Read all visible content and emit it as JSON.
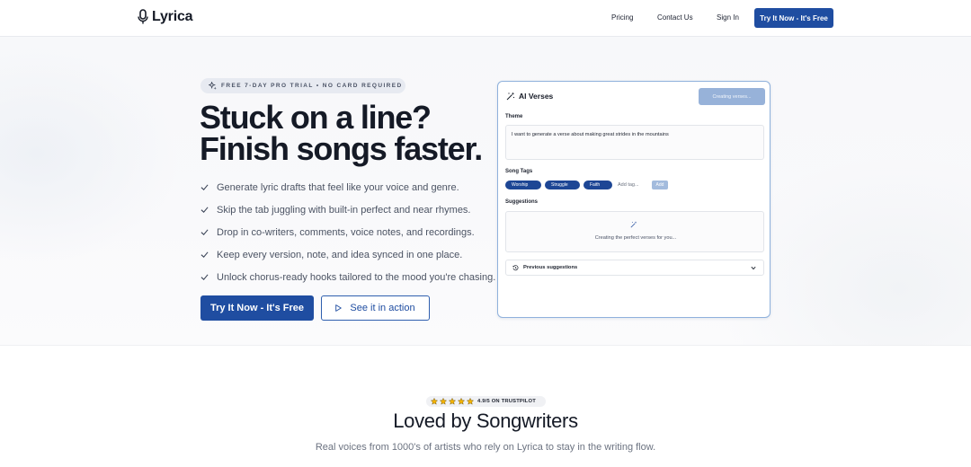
{
  "brand": {
    "name": "Lyrica"
  },
  "nav": {
    "items": [
      "Pricing",
      "Contact Us",
      "Sign In"
    ],
    "cta": "Try It Now - It's Free"
  },
  "hero": {
    "badge": "FREE 7-DAY PRO TRIAL • NO CARD REQUIRED",
    "headline_line1": "Stuck on a line?",
    "headline_line2": "Finish songs faster.",
    "features": [
      "Generate lyric drafts that feel like your voice and genre.",
      "Skip the tab juggling with built-in perfect and near rhymes.",
      "Drop in co-writers, comments, voice notes, and recordings.",
      "Keep every version, note, and idea synced in one place.",
      "Unlock chorus-ready hooks tailored to the mood you're chasing."
    ],
    "primary_button": "Try It Now - It's Free",
    "secondary_button": "See it in action"
  },
  "ai_card": {
    "title": "AI Verses",
    "status_button": "Creating verses...",
    "theme_label": "Theme",
    "theme_value": "I want to generate a verse about making great strides in the mountains",
    "tags_label": "Song Tags",
    "tags": [
      "Worship",
      "Struggle",
      "Faith"
    ],
    "tag_placeholder": "Add tag...",
    "add_button": "Add",
    "suggestions_label": "Suggestions",
    "suggestions_status": "Creating the perfect verses for you...",
    "previous_label": "Previous suggestions"
  },
  "testimonials": {
    "rating_text": "4.9/5 ON TRUSTPILOT",
    "star_count": 5,
    "title": "Loved by Songwriters",
    "subtitle": "Real voices from 1000's of artists who rely on Lyrica to stay in the writing flow."
  },
  "colors": {
    "primary": "#1f4da1",
    "tag": "#1d4695",
    "card_border": "#8fb1dc",
    "star": "#f5b400"
  },
  "icons": {
    "logo": "microphone-icon",
    "badge": "sparkle-icon",
    "feature": "check-icon",
    "secondary_button": "play-icon",
    "card_title": "magic-wand-icon",
    "suggestions": "magic-wand-icon",
    "previous": "history-icon",
    "expand": "chevron-down-icon",
    "rating": "star-icon"
  }
}
